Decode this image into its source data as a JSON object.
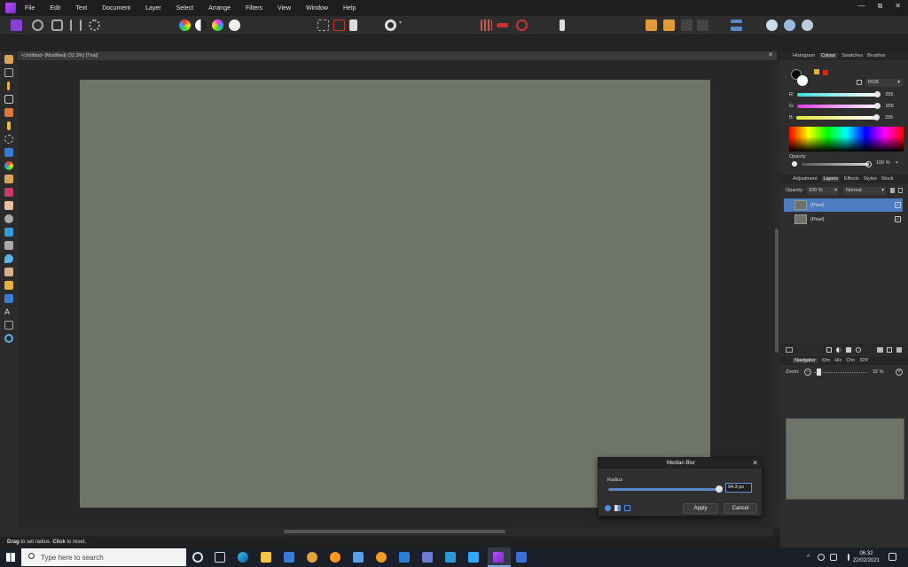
{
  "menu": [
    "File",
    "Edit",
    "Text",
    "Document",
    "Layer",
    "Select",
    "Arrange",
    "Filters",
    "View",
    "Window",
    "Help"
  ],
  "window_controls": [
    "—",
    "⧉",
    "✕"
  ],
  "document": {
    "tab_title": "<Untitled> [Modified] (32.3%) [Trial]",
    "close_glyph": "✕"
  },
  "status": {
    "bold1": "Drag",
    "text1": " to set radius. ",
    "bold2": "Click",
    "text2": " to reset."
  },
  "panel_top": {
    "tabs": [
      "Histogram",
      "Colour",
      "Swatches",
      "Brushes"
    ],
    "active_tab": "Colour",
    "mode": "RGB",
    "channels": [
      {
        "label": "R:",
        "value": "255",
        "color": "#3fd9e6"
      },
      {
        "label": "G:",
        "value": "255",
        "color": "#e03be0"
      },
      {
        "label": "B:",
        "value": "255",
        "color": "#e8e83a"
      }
    ],
    "opacity_label": "Opacity",
    "opacity_value": "100 %"
  },
  "panel_layers": {
    "tabs": [
      "Adjustment",
      "Layers",
      "Effects",
      "Styles",
      "Stock"
    ],
    "active_tab": "Layers",
    "opacity_label": "Opacity:",
    "opacity_value": "100 %",
    "blend_mode": "Normal",
    "layers": [
      {
        "name": "(Pixel)",
        "selected": true,
        "check": "✓"
      },
      {
        "name": "(Pixel)",
        "selected": false,
        "check": "✓"
      }
    ]
  },
  "panel_nav": {
    "tabs": [
      "Navigator",
      "Xfm",
      "His",
      "Chn",
      "32P"
    ],
    "active_tab": "Navigator",
    "zoom_label": "Zoom:",
    "zoom_value": "32 %"
  },
  "dialog": {
    "title": "Median Blur",
    "radius_label": "Radius",
    "radius_value": "94.3 px",
    "radius_fraction": 0.94,
    "apply": "Apply",
    "cancel": "Cancel",
    "close_glyph": "✕"
  },
  "taskbar": {
    "search_placeholder": "Type here to search",
    "time": "06:32",
    "date": "22/02/2021"
  },
  "colors": {
    "accent": "#5b88c7",
    "canvas": "#6f7468",
    "brand": "#9b3ee8"
  }
}
